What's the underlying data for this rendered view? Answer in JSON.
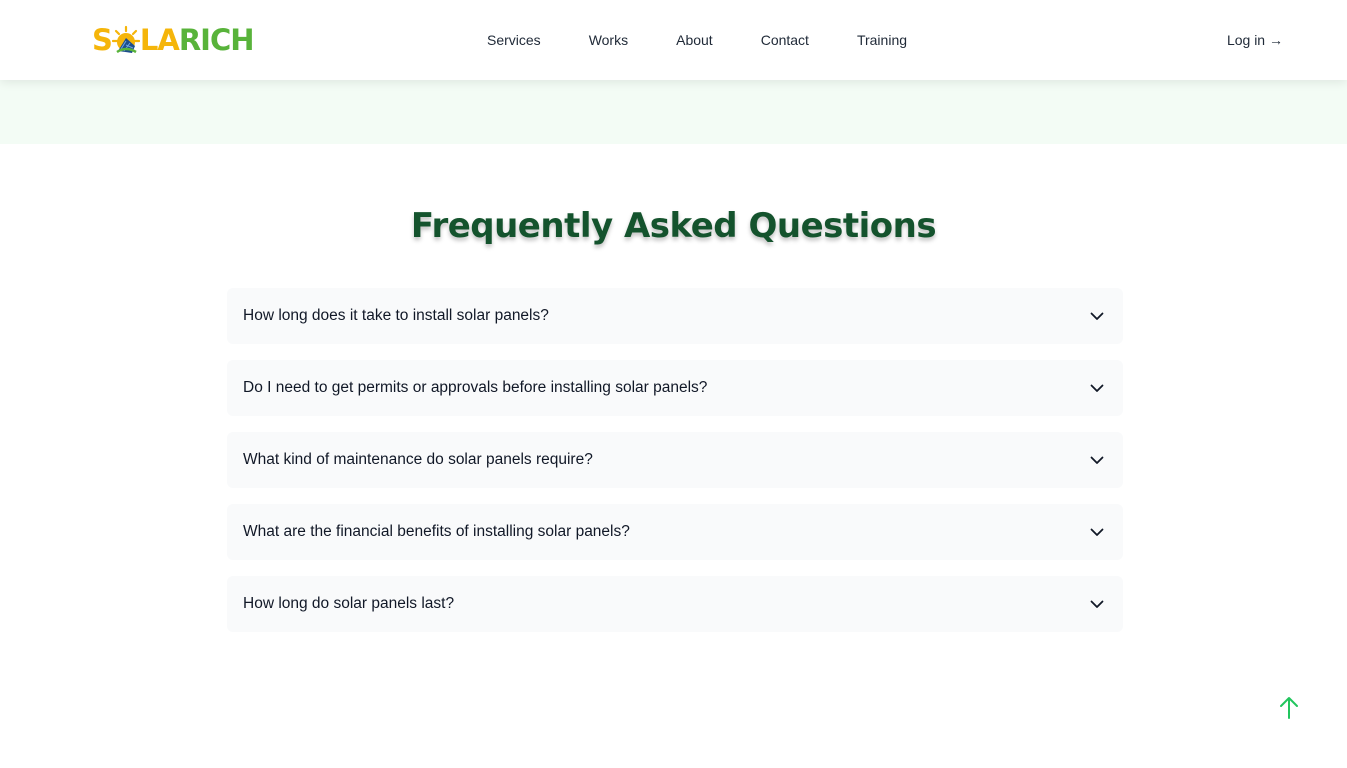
{
  "header": {
    "logo": {
      "part1": "S",
      "part2": "LA",
      "part3": "RICH",
      "alt": "SOLARICH"
    },
    "nav": [
      {
        "label": "Services"
      },
      {
        "label": "Works"
      },
      {
        "label": "About"
      },
      {
        "label": "Contact"
      },
      {
        "label": "Training"
      }
    ],
    "login_label": "Log in →"
  },
  "faq": {
    "title": "Frequently Asked Questions",
    "items": [
      {
        "question": "How long does it take to install solar panels?"
      },
      {
        "question": "Do I need to get permits or approvals before installing solar panels?"
      },
      {
        "question": "What kind of maintenance do solar panels require?"
      },
      {
        "question": "What are the financial benefits of installing solar panels?"
      },
      {
        "question": "How long do solar panels last?"
      }
    ],
    "expand_icon": "chevron-down-icon"
  },
  "scroll_top": {
    "icon": "arrow-up-icon"
  },
  "colors": {
    "brand_yellow": "#f5b50a",
    "brand_green": "#58b33a",
    "title_green": "#14532d",
    "accent_green": "#22c55e",
    "band_green": "#f3fcf5"
  }
}
